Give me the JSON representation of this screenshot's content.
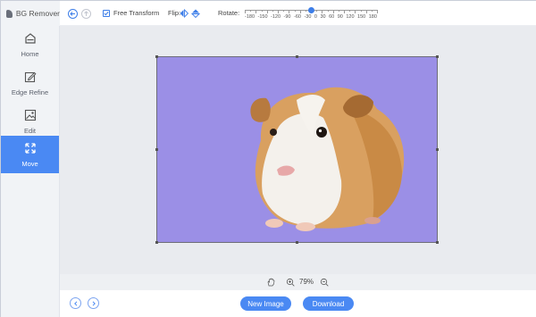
{
  "app": {
    "title": "BG Remover",
    "logo_icon": "cloud-logo-icon"
  },
  "sidebar": {
    "items": [
      {
        "label": "Home",
        "icon": "home-icon",
        "active": false
      },
      {
        "label": "Edge Refine",
        "icon": "pen-edit-icon",
        "active": false
      },
      {
        "label": "Edit",
        "icon": "image-edit-icon",
        "active": false
      },
      {
        "label": "Move",
        "icon": "move-arrows-icon",
        "active": true
      }
    ]
  },
  "toolbar": {
    "free_transform_label": "Free Transform",
    "free_transform_checked": true,
    "flip_label": "Flip:",
    "rotate_label": "Rotate:",
    "rotate_ticks": [
      "-180",
      "-150",
      "-120",
      "-90",
      "-60",
      "-30",
      "0",
      "30",
      "60",
      "90",
      "120",
      "150",
      "180"
    ],
    "rotate_value": 0
  },
  "status": {
    "zoom": "79%"
  },
  "bottom": {
    "new_image_label": "New Image",
    "download_label": "Download"
  },
  "colors": {
    "accent": "#4a89f3",
    "canvas_background": "#9b8fe6",
    "sidebar": "#f1f3f6",
    "workspace": "#e9ebef"
  }
}
